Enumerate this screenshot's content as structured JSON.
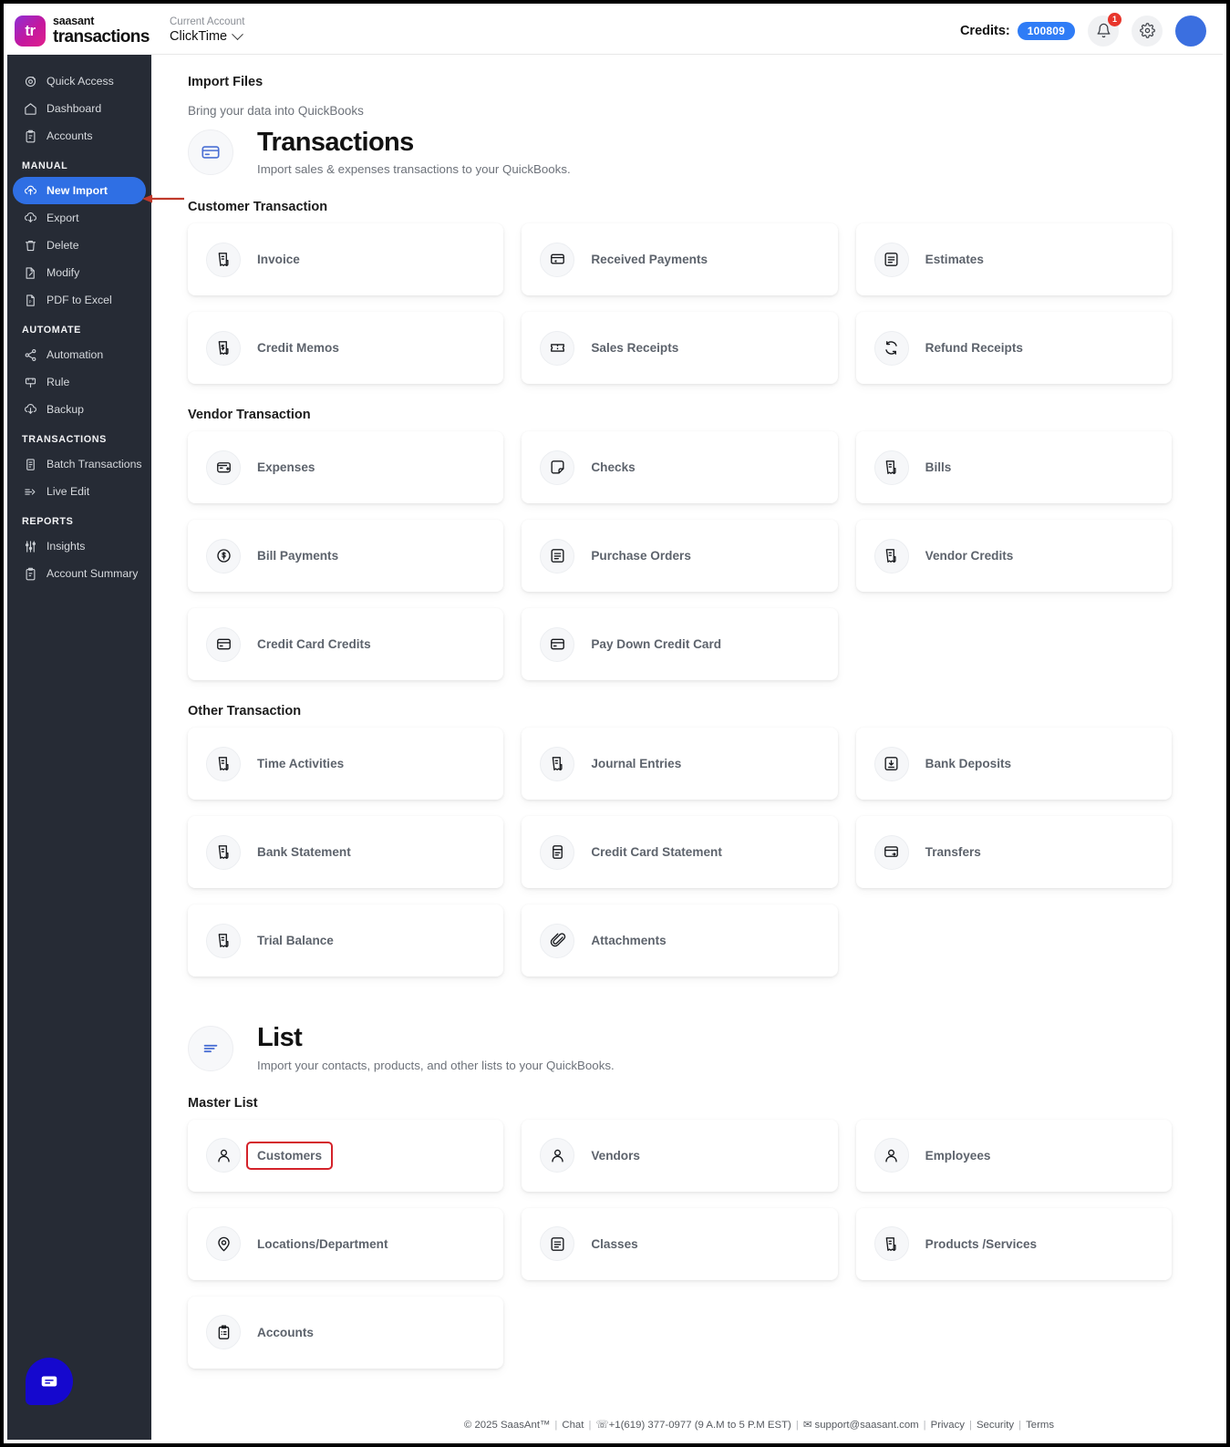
{
  "topbar": {
    "brand_line1": "saasant",
    "brand_line2": "transactions",
    "brand_mark": "tr",
    "account_label": "Current Account",
    "account_value": "ClickTime",
    "credits_label": "Credits:",
    "credits_value": "100809",
    "notification_count": "1"
  },
  "sidebar": {
    "items": [
      {
        "label": "Quick Access",
        "icon": "target-icon",
        "active": false
      },
      {
        "label": "Dashboard",
        "icon": "home-icon",
        "active": false
      },
      {
        "label": "Accounts",
        "icon": "clipboard-icon",
        "active": false
      }
    ],
    "sections": [
      {
        "title": "MANUAL",
        "items": [
          {
            "label": "New Import",
            "icon": "upload-cloud-icon",
            "active": true
          },
          {
            "label": "Export",
            "icon": "download-cloud-icon",
            "active": false
          },
          {
            "label": "Delete",
            "icon": "trash-icon",
            "active": false
          },
          {
            "label": "Modify",
            "icon": "file-edit-icon",
            "active": false
          },
          {
            "label": "PDF to Excel",
            "icon": "pdf-file-icon",
            "active": false
          }
        ]
      },
      {
        "title": "AUTOMATE",
        "items": [
          {
            "label": "Automation",
            "icon": "share-nodes-icon",
            "active": false
          },
          {
            "label": "Rule",
            "icon": "rule-icon",
            "active": false
          },
          {
            "label": "Backup",
            "icon": "download-cloud-icon",
            "active": false
          }
        ]
      },
      {
        "title": "TRANSACTIONS",
        "items": [
          {
            "label": "Batch Transactions",
            "icon": "document-icon",
            "active": false
          },
          {
            "label": "Live Edit",
            "icon": "pencil-line-icon",
            "active": false
          }
        ]
      },
      {
        "title": "REPORTS",
        "items": [
          {
            "label": "Insights",
            "icon": "sliders-icon",
            "active": false
          },
          {
            "label": "Account Summary",
            "icon": "clipboard-icon",
            "active": false
          }
        ]
      }
    ]
  },
  "main": {
    "page_title": "Import Files",
    "page_subtitle": "Bring your data into QuickBooks",
    "sections": [
      {
        "icon": "credit-card-icon",
        "title": "Transactions",
        "desc": "Import sales & expenses transactions to your QuickBooks.",
        "groups": [
          {
            "title": "Customer Transaction",
            "cards": [
              {
                "label": "Invoice",
                "icon": "invoice-icon"
              },
              {
                "label": "Received Payments",
                "icon": "payment-card-icon"
              },
              {
                "label": "Estimates",
                "icon": "document-lines-icon"
              },
              {
                "label": "Credit Memos",
                "icon": "money-note-icon"
              },
              {
                "label": "Sales Receipts",
                "icon": "ticket-icon"
              },
              {
                "label": "Refund Receipts",
                "icon": "refresh-icon"
              }
            ]
          },
          {
            "title": "Vendor Transaction",
            "cards": [
              {
                "label": "Expenses",
                "icon": "wallet-plus-icon"
              },
              {
                "label": "Checks",
                "icon": "check-page-icon"
              },
              {
                "label": "Bills",
                "icon": "invoice-icon"
              },
              {
                "label": "Bill Payments",
                "icon": "dollar-circle-icon"
              },
              {
                "label": "Purchase Orders",
                "icon": "document-lines-icon"
              },
              {
                "label": "Vendor Credits",
                "icon": "invoice-icon"
              },
              {
                "label": "Credit Card Credits",
                "icon": "credit-card-icon"
              },
              {
                "label": "Pay Down Credit Card",
                "icon": "credit-card-icon"
              },
              {
                "label": "",
                "icon": ""
              }
            ]
          },
          {
            "title": "Other Transaction",
            "cards": [
              {
                "label": "Time Activities",
                "icon": "invoice-icon"
              },
              {
                "label": "Journal Entries",
                "icon": "invoice-icon"
              },
              {
                "label": "Bank Deposits",
                "icon": "deposit-icon"
              },
              {
                "label": "Bank Statement",
                "icon": "invoice-icon"
              },
              {
                "label": "Credit Card Statement",
                "icon": "card-statement-icon"
              },
              {
                "label": "Transfers",
                "icon": "transfer-icon"
              },
              {
                "label": "Trial Balance",
                "icon": "invoice-icon"
              },
              {
                "label": "Attachments",
                "icon": "paperclip-icon"
              },
              {
                "label": "",
                "icon": ""
              }
            ]
          }
        ]
      },
      {
        "icon": "list-lines-icon",
        "title": "List",
        "desc": "Import your contacts, products, and other lists to your QuickBooks.",
        "groups": [
          {
            "title": "Master List",
            "cards": [
              {
                "label": "Customers",
                "icon": "person-icon",
                "highlighted": true
              },
              {
                "label": "Vendors",
                "icon": "person-icon"
              },
              {
                "label": "Employees",
                "icon": "person-icon"
              },
              {
                "label": "Locations/Department",
                "icon": "map-pin-icon"
              },
              {
                "label": "Classes",
                "icon": "document-lines-icon"
              },
              {
                "label": "Products /Services",
                "icon": "invoice-icon"
              },
              {
                "label": "Accounts",
                "icon": "clipboard-list-icon"
              },
              {
                "label": "",
                "icon": ""
              },
              {
                "label": "",
                "icon": ""
              }
            ]
          }
        ]
      }
    ]
  },
  "footer": {
    "copyright": "© 2025 SaasAnt™",
    "chat": "Chat",
    "phone": "+1(619) 377-0977 (9 A.M to 5 P.M EST)",
    "email": "support@saasant.com",
    "privacy": "Privacy",
    "security": "Security",
    "terms": "Terms"
  },
  "colors": {
    "accent": "#2f6fe4",
    "sidebar_bg": "#262b35",
    "credits_pill": "#2f7cf6",
    "highlight": "#d4222a",
    "chat_bubble": "#1508ce"
  }
}
